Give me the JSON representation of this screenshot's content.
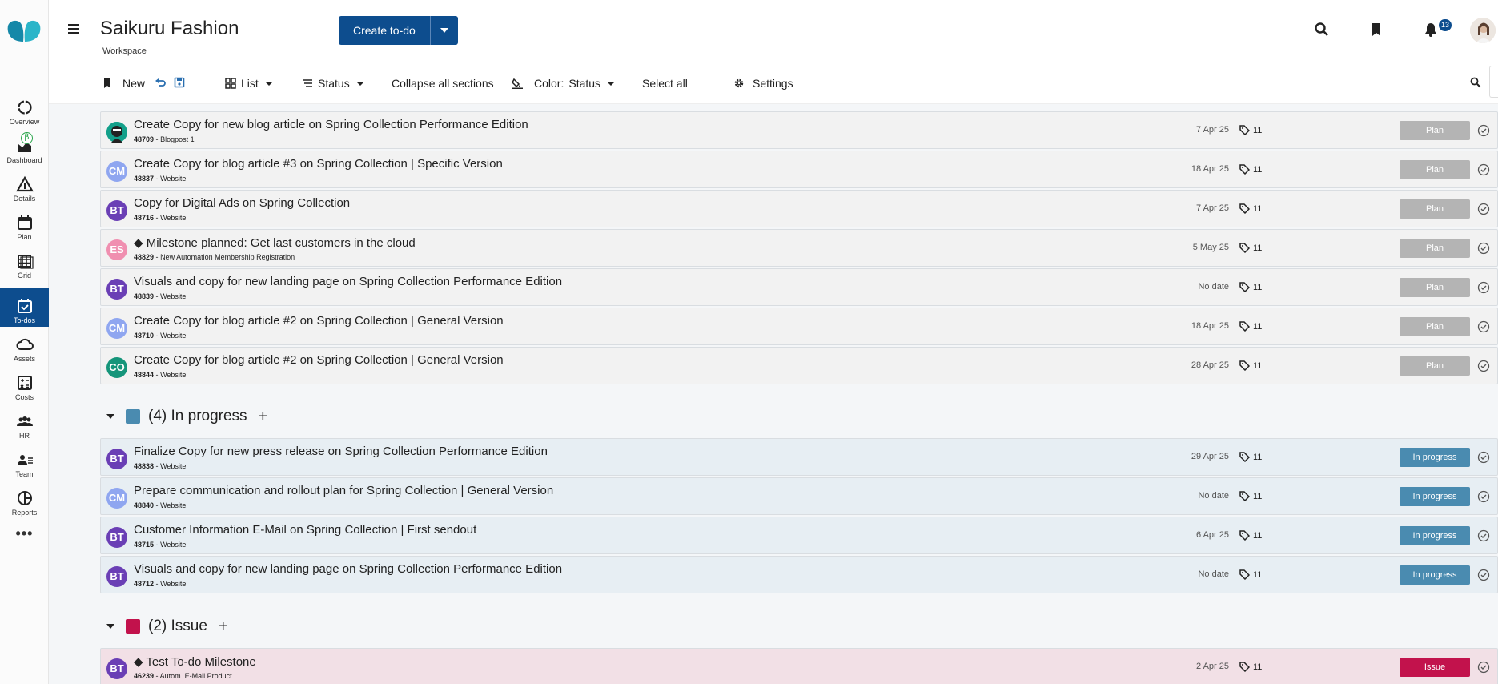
{
  "header": {
    "title": "Saikuru Fashion",
    "subtitle": "Workspace",
    "create_label": "Create to-do",
    "notification_count": "13"
  },
  "sidebar": {
    "items": [
      {
        "label": "Overview",
        "icon": "overview-icon"
      },
      {
        "label": "Dashboard",
        "icon": "dashboard-icon",
        "badge": "β"
      },
      {
        "label": "Details",
        "icon": "details-icon"
      },
      {
        "label": "Plan",
        "icon": "calendar-icon"
      },
      {
        "label": "Grid",
        "icon": "grid-icon"
      },
      {
        "label": "To-dos",
        "icon": "todo-icon",
        "active": true
      },
      {
        "label": "Assets",
        "icon": "cloud-icon"
      },
      {
        "label": "Costs",
        "icon": "calculator-icon"
      },
      {
        "label": "HR",
        "icon": "people-icon"
      },
      {
        "label": "Team",
        "icon": "team-icon"
      },
      {
        "label": "Reports",
        "icon": "pie-icon"
      }
    ],
    "more": "•••"
  },
  "toolbar": {
    "new_label": "New",
    "view_label": "List",
    "group_label": "Status",
    "collapse_label": "Collapse all sections",
    "color_label": "Color:",
    "color_value": "Status",
    "select_all_label": "Select all",
    "settings_label": "Settings"
  },
  "sections": {
    "plan": {
      "rows": [
        {
          "title": "Create Copy for new blog article on Spring Collection Performance Edition",
          "id": "48709",
          "context": "Blogpost 1",
          "date": "7 Apr 25",
          "tags": "11",
          "status": "Plan",
          "avatar": ""
        },
        {
          "title": "Create Copy for blog article #3 on Spring Collection | Specific Version",
          "id": "48837",
          "context": "Website",
          "date": "18 Apr 25",
          "tags": "11",
          "status": "Plan",
          "avatar": "CM"
        },
        {
          "title": "Copy for Digital Ads on Spring Collection",
          "id": "48716",
          "context": "Website",
          "date": "7 Apr 25",
          "tags": "11",
          "status": "Plan",
          "avatar": "BT"
        },
        {
          "title": "◆ Milestone planned: Get last customers in the cloud",
          "id": "48829",
          "context": "New Automation Membership Registration",
          "date": "5 May 25",
          "tags": "11",
          "status": "Plan",
          "avatar": "ES"
        },
        {
          "title": "Visuals and copy for new landing page on Spring Collection Performance Edition",
          "id": "48839",
          "context": "Website",
          "date": "No date",
          "tags": "11",
          "status": "Plan",
          "avatar": "BT"
        },
        {
          "title": "Create Copy for blog article #2 on Spring Collection | General Version",
          "id": "48710",
          "context": "Website",
          "date": "18 Apr 25",
          "tags": "11",
          "status": "Plan",
          "avatar": "CM"
        },
        {
          "title": "Create Copy for blog article #2 on Spring Collection | General Version",
          "id": "48844",
          "context": "Website",
          "date": "28 Apr 25",
          "tags": "11",
          "status": "Plan",
          "avatar": "CO"
        }
      ]
    },
    "in_progress": {
      "title": "(4) In progress",
      "add": "+",
      "color": "#4a8bb0",
      "rows": [
        {
          "title": "Finalize Copy for new press release on Spring Collection Performance Edition",
          "id": "48838",
          "context": "Website",
          "date": "29 Apr 25",
          "tags": "11",
          "status": "In progress",
          "avatar": "BT"
        },
        {
          "title": "Prepare communication and rollout plan for Spring Collection | General Version",
          "id": "48840",
          "context": "Website",
          "date": "No date",
          "tags": "11",
          "status": "In progress",
          "avatar": "CM"
        },
        {
          "title": "Customer Information E-Mail on Spring Collection | First sendout",
          "id": "48715",
          "context": "Website",
          "date": "6 Apr 25",
          "tags": "11",
          "status": "In progress",
          "avatar": "BT"
        },
        {
          "title": "Visuals and copy for new landing page on Spring Collection Performance Edition",
          "id": "48712",
          "context": "Website",
          "date": "No date",
          "tags": "11",
          "status": "In progress",
          "avatar": "BT"
        }
      ]
    },
    "issue": {
      "title": "(2) Issue",
      "add": "+",
      "color": "#c2124c",
      "rows": [
        {
          "title": "◆ Test To-do Milestone",
          "id": "46239",
          "context": "Autom. E-Mail Product",
          "date": "2 Apr 25",
          "tags": "11",
          "status": "Issue",
          "avatar": "BT"
        }
      ]
    }
  },
  "meta_separator": "-",
  "avatar_colors": {
    "BT": "#6a3fb5",
    "CM": "#8fa6f0",
    "ES": "#f08fb0",
    "CO": "#15957a"
  }
}
